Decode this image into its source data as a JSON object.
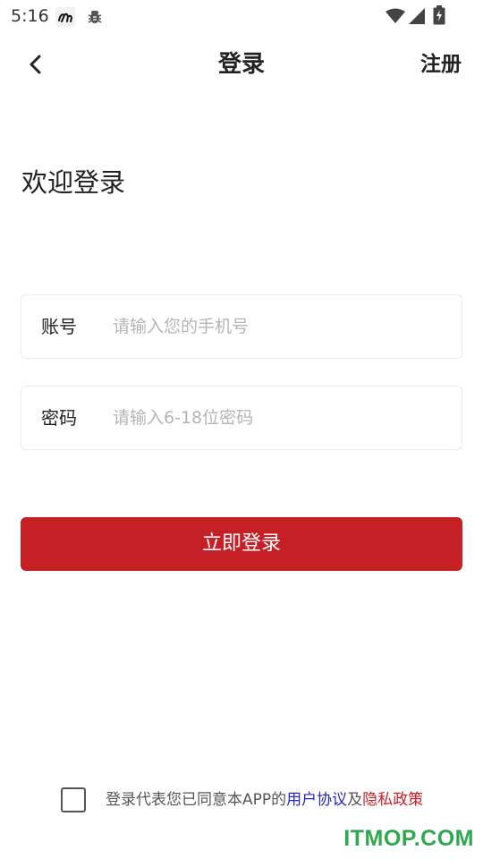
{
  "status_bar": {
    "time": "5:16",
    "icons": [
      "app-notification-icon",
      "bug-icon",
      "wifi-icon",
      "cellular-signal-icon",
      "battery-charging-icon"
    ]
  },
  "nav": {
    "title": "登录",
    "register_label": "注册",
    "back_icon": "chevron-left-icon"
  },
  "welcome": "欢迎登录",
  "form": {
    "account": {
      "label": "账号",
      "placeholder": "请输入您的手机号",
      "value": ""
    },
    "password": {
      "label": "密码",
      "placeholder": "请输入6-18位密码",
      "value": ""
    }
  },
  "login_button": "立即登录",
  "agreement": {
    "checked": false,
    "prefix": "登录代表您已同意本APP的",
    "user_agreement": "用户协议",
    "conjunction": "及",
    "privacy_policy": "隐私政策"
  },
  "watermark": "ITMOP.COM",
  "colors": {
    "accent": "#c62027",
    "link_blue": "#2626c8",
    "watermark_green": "#2fa84f"
  }
}
